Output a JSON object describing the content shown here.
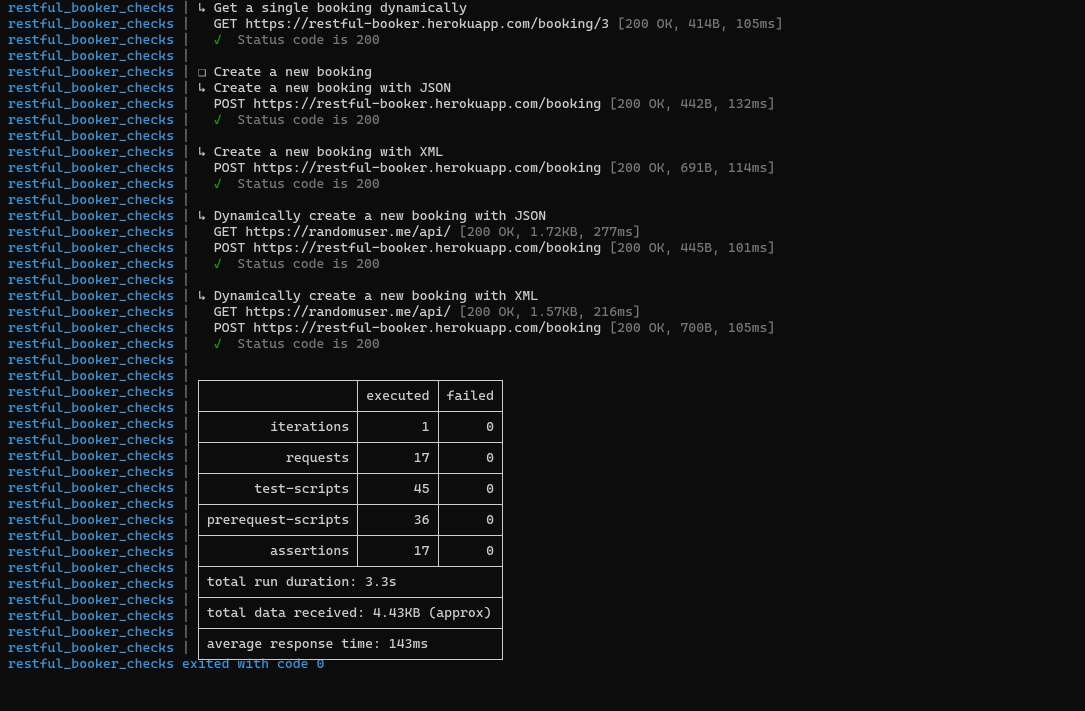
{
  "prefix": "restful_booker_checks",
  "pipe": " | ",
  "symbols": {
    "corner": "↳",
    "folder": "❏",
    "check": "✓"
  },
  "blocks": [
    {
      "corner": true,
      "text": "Get a single booking dynamically"
    },
    {
      "text": "GET https://restful-booker.herokuapp.com/booking/3 ",
      "bracket": "[200 OK, 414B, 105ms]"
    },
    {
      "check": true,
      "text": "Status code is 200"
    },
    {
      "blank": true
    },
    {
      "folder": true,
      "text": "Create a new booking"
    },
    {
      "corner": true,
      "text": "Create a new booking with JSON"
    },
    {
      "text": "POST https://restful-booker.herokuapp.com/booking ",
      "bracket": "[200 OK, 442B, 132ms]"
    },
    {
      "check": true,
      "text": "Status code is 200"
    },
    {
      "blank": true
    },
    {
      "corner": true,
      "text": "Create a new booking with XML"
    },
    {
      "text": "POST https://restful-booker.herokuapp.com/booking ",
      "bracket": "[200 OK, 691B, 114ms]"
    },
    {
      "check": true,
      "text": "Status code is 200"
    },
    {
      "blank": true
    },
    {
      "corner": true,
      "text": "Dynamically create a new booking with JSON"
    },
    {
      "text": "GET https://randomuser.me/api/ ",
      "bracket": "[200 OK, 1.72KB, 277ms]"
    },
    {
      "text": "POST https://restful-booker.herokuapp.com/booking ",
      "bracket": "[200 OK, 445B, 101ms]"
    },
    {
      "check": true,
      "text": "Status code is 200"
    },
    {
      "blank": true
    },
    {
      "corner": true,
      "text": "Dynamically create a new booking with XML"
    },
    {
      "text": "GET https://randomuser.me/api/ ",
      "bracket": "[200 OK, 1.57KB, 216ms]"
    },
    {
      "text": "POST https://restful-booker.herokuapp.com/booking ",
      "bracket": "[200 OK, 700B, 105ms]"
    },
    {
      "check": true,
      "text": "Status code is 200"
    },
    {
      "blank": true
    }
  ],
  "table": {
    "headers": [
      "",
      "executed",
      "failed"
    ],
    "rows": [
      {
        "label": "iterations",
        "executed": "1",
        "failed": "0"
      },
      {
        "label": "requests",
        "executed": "17",
        "failed": "0"
      },
      {
        "label": "test-scripts",
        "executed": "45",
        "failed": "0"
      },
      {
        "label": "prerequest-scripts",
        "executed": "36",
        "failed": "0"
      },
      {
        "label": "assertions",
        "executed": "17",
        "failed": "0"
      }
    ],
    "footer": [
      "total run duration: 3.3s",
      "total data received: 4.43KB (approx)",
      "average response time: 143ms"
    ]
  },
  "exit_line": "restful_booker_checks exited with code 0"
}
